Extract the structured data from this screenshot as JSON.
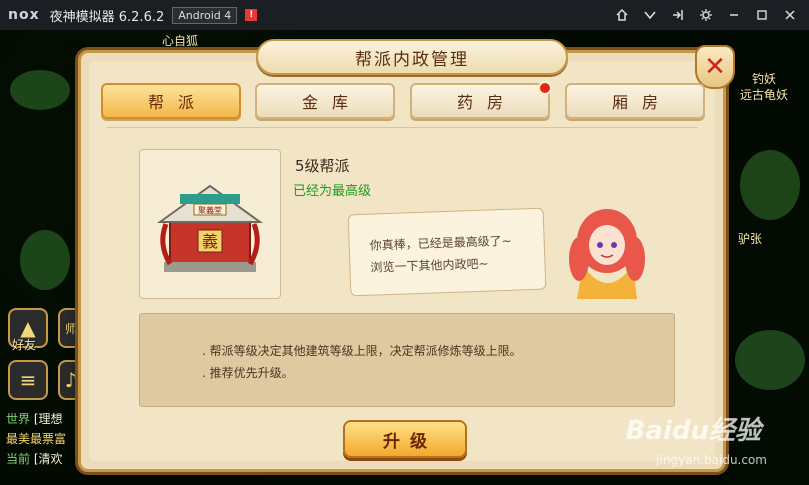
{
  "window": {
    "logo": "nox",
    "title": "夜神模拟器 6.2.6.2",
    "android_badge": "Android 4",
    "alert_badge": "!",
    "controls": [
      "home-icon",
      "chevron-down-icon",
      "exit-fullscreen-icon",
      "gear-icon",
      "minimize-icon",
      "maximize-icon",
      "close-icon"
    ]
  },
  "hud": {
    "top_left_name": "心自狐",
    "right_name_1": "钓妖",
    "right_name_2": "远古龟妖",
    "right_name_3": "驴张",
    "friends_label": "好友",
    "side_tag": "师",
    "chat": [
      {
        "channel": "世界",
        "text": "[理想"
      },
      {
        "channel": "",
        "text": "最美最票富"
      },
      {
        "channel": "当前",
        "text": "[清欢"
      }
    ]
  },
  "dialog": {
    "title": "帮派内政管理",
    "tabs": [
      {
        "label": "帮派",
        "active": true,
        "badge": false
      },
      {
        "label": "金库",
        "active": false,
        "badge": false
      },
      {
        "label": "药房",
        "active": false,
        "badge": true
      },
      {
        "label": "厢房",
        "active": false,
        "badge": false
      }
    ],
    "level_title": "5级帮派",
    "level_status": "已经为最高级",
    "building_sign": "義",
    "building_plaque": "聚義堂",
    "bubble_lines": [
      "你真棒，已经是最高级了~",
      "浏览一下其他内政吧~"
    ],
    "info_lines": [
      ". 帮派等级决定其他建筑等级上限，决定帮派修炼等级上限。",
      ". 推荐优先升级。"
    ],
    "upgrade_label": "升级"
  },
  "watermark": {
    "brand": "Baidu经验",
    "url": "jingyan.baidu.com"
  },
  "colors": {
    "accent_gold": "#f2b84a",
    "status_green": "#1e9b1e",
    "close_red": "#d0221d"
  }
}
